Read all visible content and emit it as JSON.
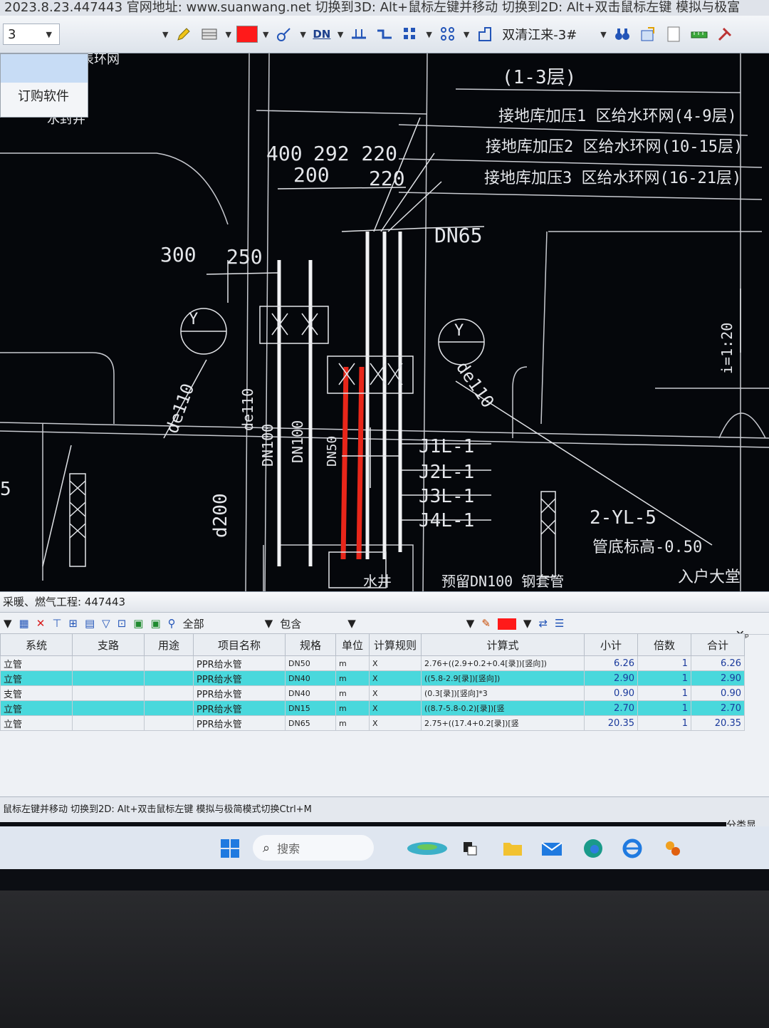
{
  "titlebar": {
    "text": "2023.8.23.447443 官网地址: www.suanwang.net 切换到3D: Alt+鼠标左键并移动 切换到2D: Alt+双击鼠标左键 模拟与极富"
  },
  "toolbar": {
    "floor_value": "3",
    "drawing_name": "双清江来-3#",
    "dn_label": "DN",
    "color_accent": "#ff1a1a"
  },
  "popup": {
    "item_label": "订购软件"
  },
  "cad": {
    "texts": {
      "floors_1_3": "(1-3层)",
      "ring1": "接地库加压1 区给水环网(4-9层)",
      "ring2": "接地库加压2 区给水环网(10-15层)",
      "ring3": "接地库加压3 区给水环网(16-21层)",
      "top_left": "入户水表环网",
      "seal": "水封井",
      "dim_400": "400",
      "dim_top": "292 220",
      "dim_200": "200",
      "dim_220": "220",
      "dim_300": "300",
      "dim_250": "250",
      "dn65": "DN65",
      "de110_a": "de110",
      "de110_b": "de110",
      "de110_c": "de110",
      "dn100_a": "DN100",
      "dn100_b": "DN100",
      "dn50": "DN50",
      "d200": "d200",
      "j1": "J1L-1",
      "j2": "J2L-1",
      "j3": "J3L-1",
      "j4": "J4L-1",
      "yl5": "2-YL-5",
      "pipe_bottom": "管底标高-0.50",
      "entry": "入户大堂",
      "sleeve": "预留DN100 钢套管",
      "slope": "i=1:20",
      "well": "水井",
      "left5": "5"
    }
  },
  "panel": {
    "title": "采暖、燃气工程: 447443",
    "tools": {
      "all": "全部",
      "contain": "包含"
    },
    "columns": [
      "系统",
      "支路",
      "用途",
      "项目名称",
      "规格",
      "单位",
      "计算规则",
      "计算式",
      "小计",
      "倍数",
      "合计"
    ],
    "rows": [
      {
        "system": "立管",
        "branch": "",
        "use": "",
        "name": "PPR给水管",
        "spec": "DN50",
        "unit": "m",
        "rule": "X",
        "formula": "2.76+((2.9+0.2+0.4[录])[竖向])",
        "subtotal": "6.26",
        "multiple": "1",
        "total": "6.26",
        "selected": false
      },
      {
        "system": "立管",
        "branch": "",
        "use": "",
        "name": "PPR给水管",
        "spec": "DN40",
        "unit": "m",
        "rule": "X",
        "formula": "((5.8-2.9[录])[竖向])",
        "subtotal": "2.90",
        "multiple": "1",
        "total": "2.90",
        "selected": true
      },
      {
        "system": "支管",
        "branch": "",
        "use": "",
        "name": "PPR给水管",
        "spec": "DN40",
        "unit": "m",
        "rule": "X",
        "formula": "(0.3[录])[竖向]*3",
        "subtotal": "0.90",
        "multiple": "1",
        "total": "0.90",
        "selected": false
      },
      {
        "system": "立管",
        "branch": "",
        "use": "",
        "name": "PPR给水管",
        "spec": "DN15",
        "unit": "m",
        "rule": "X",
        "formula": "((8.7-5.8-0.2)[录])[竖",
        "subtotal": "2.70",
        "multiple": "1",
        "total": "2.70",
        "selected": true
      },
      {
        "system": "立管",
        "branch": "",
        "use": "",
        "name": "PPR给水管",
        "spec": "DN65",
        "unit": "m",
        "rule": "X",
        "formula": "2.75+((17.4+0.2[录])[竖",
        "subtotal": "20.35",
        "multiple": "1",
        "total": "20.35",
        "selected": false
      }
    ]
  },
  "statusbar": {
    "text": "鼠标左键并移动 切换到2D: Alt+双击鼠标左键 模拟与极简模式切换Ctrl+M",
    "classify": "分类显"
  },
  "taskbar": {
    "search_placeholder": "搜索"
  },
  "colors": {
    "selected_row": "#49d8dc",
    "red_pipe": "#e8261a",
    "cad_background": "#05070b"
  }
}
